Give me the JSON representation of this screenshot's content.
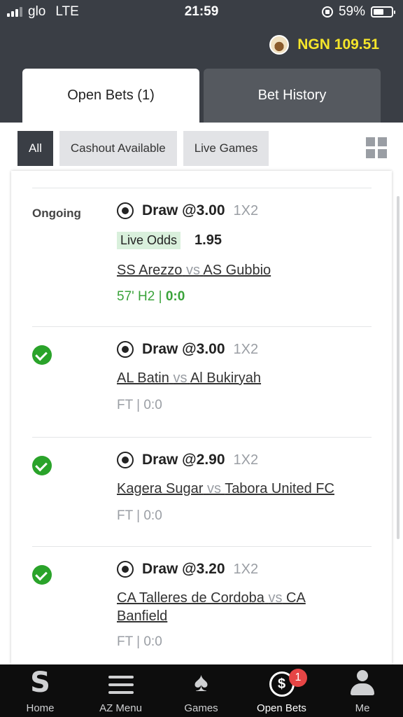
{
  "status_bar": {
    "carrier": "glo",
    "network": "LTE",
    "time": "21:59",
    "battery": "59%",
    "battery_level": 0.59
  },
  "header": {
    "balance": "NGN 109.51",
    "tabs": [
      {
        "label": "Open Bets (1)",
        "active": true
      },
      {
        "label": "Bet History",
        "active": false
      }
    ]
  },
  "filters": {
    "chips": [
      {
        "label": "All",
        "active": true
      },
      {
        "label": "Cashout Available",
        "active": false
      },
      {
        "label": "Live Games",
        "active": false
      }
    ],
    "grid_icon": "grid-view-icon"
  },
  "bets": [
    {
      "status": "Ongoing",
      "sport_icon": "soccer-ball-icon",
      "pick": "Draw @3.00",
      "market": "1X2",
      "live_odds_label": "Live Odds",
      "live_odds_value": "1.95",
      "home": "SS Arezzo",
      "vs": "vs",
      "away": "AS Gubbio",
      "score_time": "57' H2 | ",
      "score_value": "0:0"
    },
    {
      "status": "won",
      "sport_icon": "soccer-ball-icon",
      "pick": "Draw @3.00",
      "market": "1X2",
      "home": "AL Batin",
      "vs": "vs",
      "away": "Al Bukiryah",
      "score": "FT | 0:0"
    },
    {
      "status": "won",
      "sport_icon": "soccer-ball-icon",
      "pick": "Draw @2.90",
      "market": "1X2",
      "home": "Kagera Sugar",
      "vs": "vs",
      "away": "Tabora United FC",
      "score": "FT | 0:0"
    },
    {
      "status": "won",
      "sport_icon": "soccer-ball-icon",
      "pick": "Draw @3.20",
      "market": "1X2",
      "home": "CA Talleres de Cordoba",
      "vs": "vs",
      "away": "CA Banfield",
      "score": "FT | 0:0"
    }
  ],
  "bottom_nav": {
    "items": [
      {
        "label": "Home",
        "icon": "home-icon"
      },
      {
        "label": "AZ Menu",
        "icon": "menu-icon"
      },
      {
        "label": "Games",
        "icon": "spade-icon"
      },
      {
        "label": "Open Bets",
        "icon": "open-bets-icon",
        "badge": "1",
        "active": true
      },
      {
        "label": "Me",
        "icon": "user-icon"
      }
    ]
  },
  "colors": {
    "header_bg": "#3a3e45",
    "balance": "#f5e52a",
    "won": "#2aa32a",
    "live": "#3aa33a",
    "badge": "#e64545"
  }
}
